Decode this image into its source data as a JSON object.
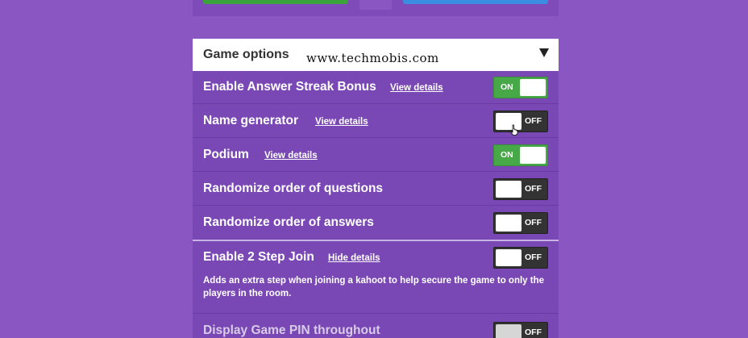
{
  "header": {
    "title": "Game options",
    "watermark": "www.techmobis.com",
    "collapse_icon": "caret-down-icon"
  },
  "colors": {
    "background": "#8a56c2",
    "panel": "#7a48b4",
    "toggle_on": "#47a847",
    "toggle_off": "#333333"
  },
  "options": [
    {
      "label": "Enable Answer Streak Bonus",
      "link": "View details",
      "state": "ON"
    },
    {
      "label": "Name generator",
      "link": "View details",
      "state": "OFF"
    },
    {
      "label": "Podium",
      "link": "View details",
      "state": "ON"
    },
    {
      "label": "Randomize order of questions",
      "link": "",
      "state": "OFF"
    },
    {
      "label": "Randomize order of answers",
      "link": "",
      "state": "OFF"
    }
  ],
  "two_step": {
    "label": "Enable 2 Step Join",
    "link": "Hide details",
    "state": "OFF",
    "description": "Adds an extra step when joining a kahoot to help secure the game to only the players in the room."
  },
  "pin_option": {
    "label": "Display Game PIN throughout",
    "state": "OFF"
  }
}
